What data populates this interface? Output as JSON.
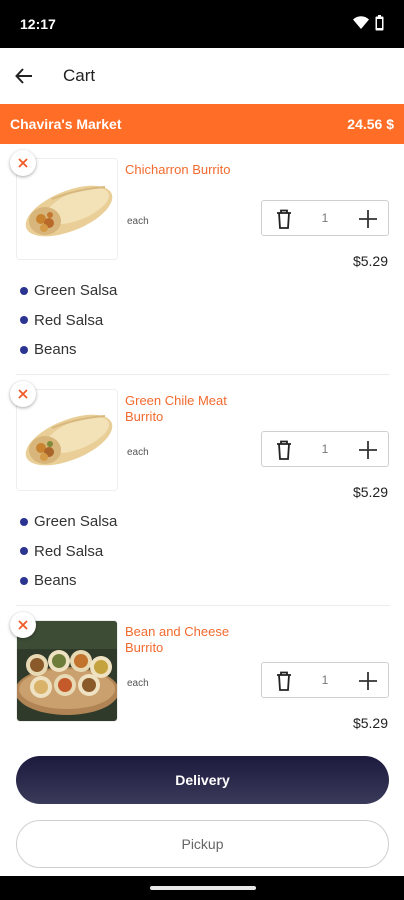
{
  "status_bar": {
    "time": "12:17",
    "icons": [
      "wifi-icon",
      "battery-icon"
    ]
  },
  "header": {
    "title": "Cart",
    "back_icon": "arrow-left-icon"
  },
  "store": {
    "name": "Chavira's Market",
    "total": "24.56 $"
  },
  "items": [
    {
      "name": "Chicharron Burrito",
      "unit": "each",
      "quantity": "1",
      "price": "$5.29",
      "image": "burrito-image",
      "options": [
        "Green Salsa",
        "Red Salsa",
        "Beans"
      ]
    },
    {
      "name": "Green Chile Meat Burrito",
      "unit": "each",
      "quantity": "1",
      "price": "$5.29",
      "image": "burrito-image",
      "options": [
        "Green Salsa",
        "Red Salsa",
        "Beans"
      ]
    },
    {
      "name": "Bean and Cheese Burrito",
      "unit": "each",
      "quantity": "1",
      "price": "$5.29",
      "image": "burrito-platter-image",
      "options": []
    }
  ],
  "actions": {
    "delivery_label": "Delivery",
    "pickup_label": "Pickup"
  },
  "colors": {
    "accent": "#ff6d26",
    "item_name": "#f26a2e",
    "option_dot": "#2b3591",
    "delivery_button": "#1c1a3d"
  }
}
